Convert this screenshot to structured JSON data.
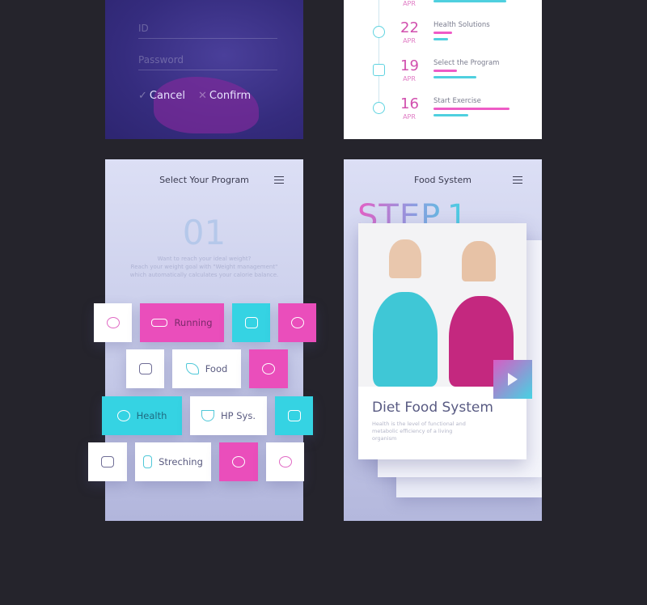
{
  "login": {
    "id_placeholder": "ID",
    "password_placeholder": "Password",
    "cancel_label": "Cancel",
    "confirm_label": "Confirm"
  },
  "timeline": {
    "items": [
      {
        "day": "22",
        "month": "APR",
        "title": "Health Solutions",
        "pink": 0.24,
        "cyan": 0.19
      },
      {
        "day": "19",
        "month": "APR",
        "title": "Select the Program",
        "pink": 0.3,
        "cyan": 0.55
      },
      {
        "day": "16",
        "month": "APR",
        "title": "Start Exercise",
        "pink": 0.97,
        "cyan": 0.44
      }
    ],
    "top_month": "APR"
  },
  "program": {
    "title": "Select Your Program",
    "number": "01",
    "desc": [
      "Want to reach your ideal weight?",
      "Reach your weight goal with \"Weight management\"",
      "which automatically calculates your calorie balance."
    ],
    "tiles": {
      "running": "Running",
      "food": "Food",
      "health": "Health",
      "hp": "HP Sys.",
      "stretching": "Streching"
    }
  },
  "food": {
    "title": "Food System",
    "step": "STEP.1",
    "card_title": "Diet Food System",
    "card_desc": "Health is the level of functional and metabolic efficiency of a living organism"
  },
  "colors": {
    "pink": "#ea4ebb",
    "cyan": "#35d3e3",
    "background": "#25242c"
  }
}
